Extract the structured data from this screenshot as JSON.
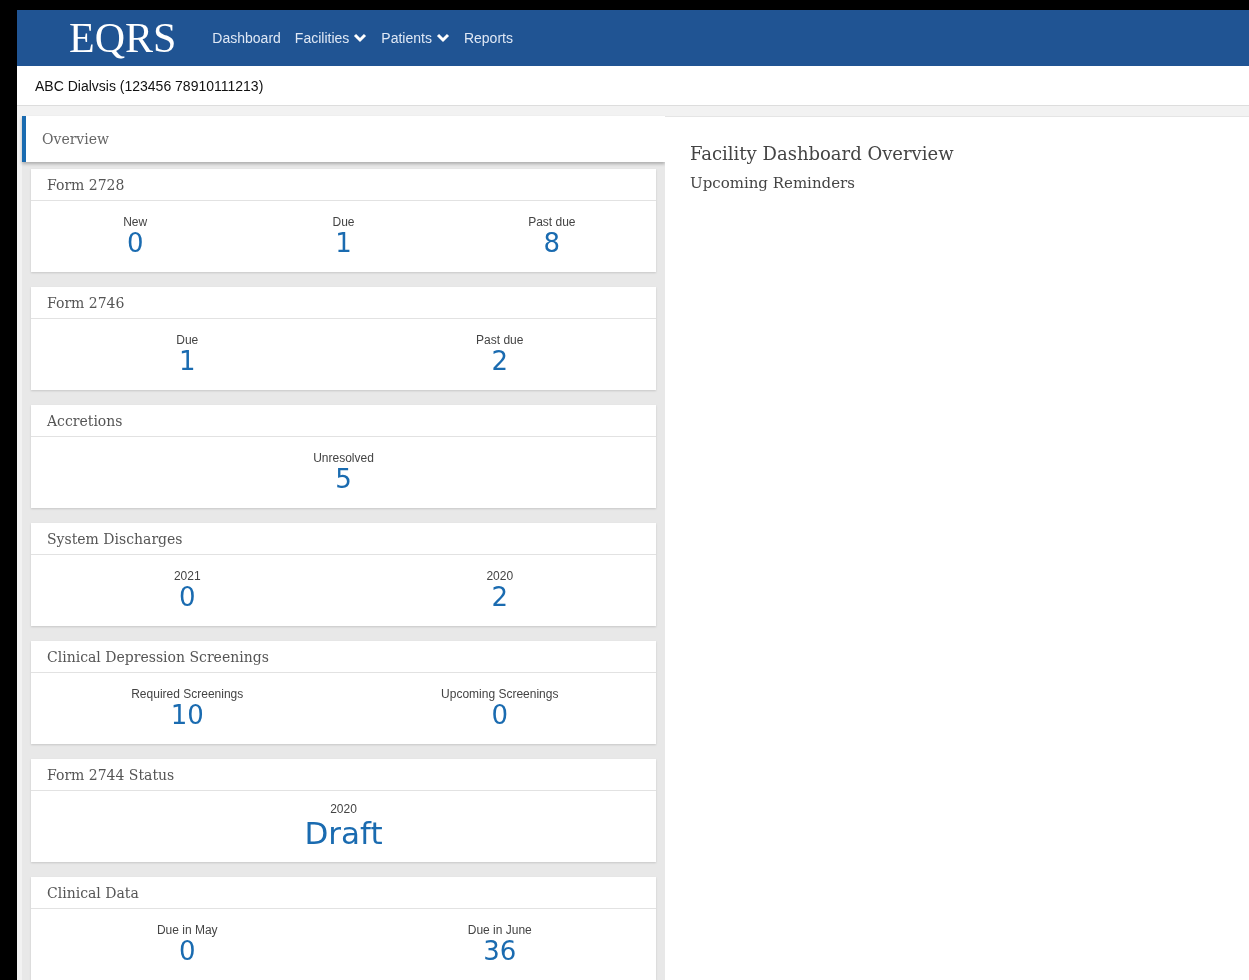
{
  "header": {
    "logo": "EQRS",
    "nav": [
      {
        "label": "Dashboard",
        "dropdown": false
      },
      {
        "label": "Facilities",
        "dropdown": true
      },
      {
        "label": "Patients",
        "dropdown": true
      },
      {
        "label": "Reports",
        "dropdown": false
      }
    ]
  },
  "facility": "ABC Dialvsis (123456 78910111213)",
  "sidebar": {
    "tab": {
      "label": "Overview",
      "selected": true
    },
    "cards": [
      {
        "title": "Form 2728",
        "stats": [
          {
            "label": "New",
            "value": "0"
          },
          {
            "label": "Due",
            "value": "1"
          },
          {
            "label": "Past due",
            "value": "8"
          }
        ]
      },
      {
        "title": "Form 2746",
        "stats": [
          {
            "label": "Due",
            "value": "1"
          },
          {
            "label": "Past due",
            "value": "2"
          }
        ]
      },
      {
        "title": "Accretions",
        "stats": [
          {
            "label": "Unresolved",
            "value": "5"
          }
        ]
      },
      {
        "title": "System Discharges",
        "stats": [
          {
            "label": "2021",
            "value": "0"
          },
          {
            "label": "2020",
            "value": "2"
          }
        ]
      },
      {
        "title": "Clinical Depression Screenings",
        "stats": [
          {
            "label": "Required Screenings",
            "value": "10"
          },
          {
            "label": "Upcoming Screenings",
            "value": "0"
          }
        ]
      },
      {
        "title": "Form 2744 Status",
        "stats": [
          {
            "label": "2020",
            "value": "Draft"
          }
        ]
      },
      {
        "title": "Clinical Data",
        "stats": [
          {
            "label": "Due in May",
            "value": "0"
          },
          {
            "label": "Due in June",
            "value": "36"
          }
        ]
      }
    ]
  },
  "main": {
    "title": "Facility Dashboard Overview",
    "subtitle": "Upcoming Reminders"
  }
}
